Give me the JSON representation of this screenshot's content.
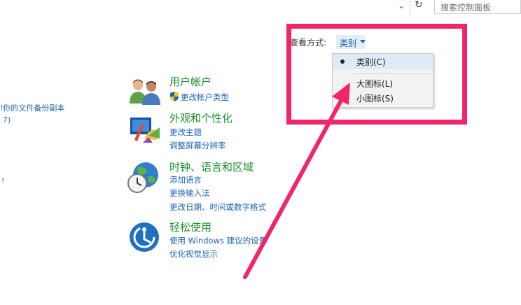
{
  "topbar": {
    "dropdown_icon": "chevron-down-icon",
    "refresh_icon": "refresh-icon",
    "search_placeholder": "搜索控制面板"
  },
  "left_partial": {
    "item1": "!你的文件备份副本",
    "item2": "7)",
    "item3": "!"
  },
  "categories": [
    {
      "title": "用户帐户",
      "links": [
        "更改帐户类型"
      ],
      "icon": "users-icon"
    },
    {
      "title": "外观和个性化",
      "links": [
        "更改主题",
        "调整屏幕分辨率"
      ],
      "icon": "appearance-icon"
    },
    {
      "title": "时钟、语言和区域",
      "links": [
        "添加语言",
        "更换输入法",
        "更改日期、时间或数字格式"
      ],
      "icon": "clock-globe-icon"
    },
    {
      "title": "轻松使用",
      "links": [
        "使用 Windows 建议的设置",
        "优化视觉显示"
      ],
      "icon": "ease-of-access-icon"
    }
  ],
  "view_by": {
    "label": "查看方式:",
    "value": "类别",
    "options": [
      "类别(C)",
      "大图标(L)",
      "小图标(S)"
    ],
    "selected_index": 0
  },
  "colors": {
    "highlight": "#f0256a",
    "title_green": "#1a8f2e",
    "link_blue": "#1e64b4"
  }
}
